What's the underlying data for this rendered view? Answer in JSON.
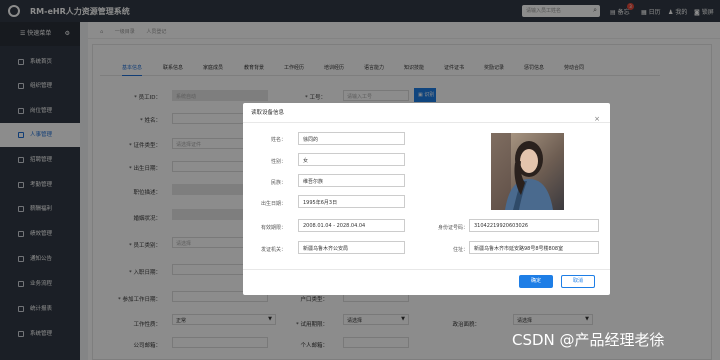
{
  "app": {
    "title": "RM-eHR人力资源管理系统"
  },
  "topbar": {
    "search_placeholder": "请输入员工姓名",
    "items": [
      "备忘",
      "日历",
      "我的",
      "锁屏"
    ],
    "badge": "3"
  },
  "sidebar": {
    "header": "快速菜单",
    "items": [
      {
        "label": "系统首页",
        "active": false
      },
      {
        "label": "组织管理",
        "active": false
      },
      {
        "label": "岗位管理",
        "active": false
      },
      {
        "label": "人事管理",
        "active": true
      },
      {
        "label": "招聘管理",
        "active": false
      },
      {
        "label": "考勤管理",
        "active": false
      },
      {
        "label": "薪酬福利",
        "active": false
      },
      {
        "label": "绩效管理",
        "active": false
      },
      {
        "label": "通知公告",
        "active": false
      },
      {
        "label": "业务流程",
        "active": false
      },
      {
        "label": "统计报表",
        "active": false
      },
      {
        "label": "系统管理",
        "active": false
      }
    ]
  },
  "breadcrumb": [
    "一级目录",
    "人员登记"
  ],
  "tabs": [
    "基本信息",
    "联系信息",
    "家庭成员",
    "教育背景",
    "工作经历",
    "培训经历",
    "语言能力",
    "知识技能",
    "证件证书",
    "奖励记录",
    "惩罚信息",
    "劳动合同"
  ],
  "form": {
    "fields": [
      {
        "label": "* 员工ID：",
        "value": "系统自动"
      },
      {
        "label": "* 工号：",
        "value": "请输入工号"
      },
      {
        "label": "* 姓名：",
        "value": ""
      },
      {
        "label": "* 证件类型：",
        "value": "请选择证件"
      },
      {
        "label": "* 出生日期：",
        "value": ""
      },
      {
        "label": "职位描述：",
        "value": ""
      },
      {
        "label": "婚姻状况：",
        "value": ""
      },
      {
        "label": "* 员工类别：",
        "value": "请选择"
      },
      {
        "label": "* 入职日期：",
        "value": ""
      },
      {
        "label": "* 参加工作日期：",
        "value": ""
      },
      {
        "label": "工作性质：",
        "value": "正常"
      },
      {
        "label": "公司邮箱：",
        "value": ""
      }
    ],
    "right_labels": [
      "户口类型：",
      "* 试用期限：",
      "试用期：",
      "个人邮箱："
    ],
    "far_right": [
      "政治面貌：",
      "请选择"
    ],
    "read_button": "识别"
  },
  "modal": {
    "title": "读取设备信息",
    "close": "×",
    "fields": [
      {
        "label": "姓名：",
        "value": "徐同的"
      },
      {
        "label": "性别：",
        "value": "女"
      },
      {
        "label": "民族：",
        "value": "维吾尔族"
      },
      {
        "label": "出生日期：",
        "value": "1995年6月3日"
      },
      {
        "label": "有效期限：",
        "value": "2008.01.04 - 2028.04.04"
      },
      {
        "label": "身份证号码：",
        "value": "31042219920603026"
      },
      {
        "label": "发证机关：",
        "value": "新疆乌鲁木齐公安局"
      },
      {
        "label": "住址：",
        "value": "新疆乌鲁木齐市延安路98号8号楼808室"
      }
    ],
    "ok": "确定",
    "cancel": "取消"
  },
  "watermark": "CSDN @产品经理老徐",
  "colors": {
    "sidebar_bg": "#323a45",
    "accent": "#1e7ee6",
    "badge": "#e64a3b"
  },
  "icons": [
    "logo-icon",
    "search-icon",
    "memo-icon",
    "calendar-icon",
    "user-icon",
    "lock-icon",
    "gear-icon",
    "home-icon",
    "close-icon",
    "id-card-icon"
  ]
}
